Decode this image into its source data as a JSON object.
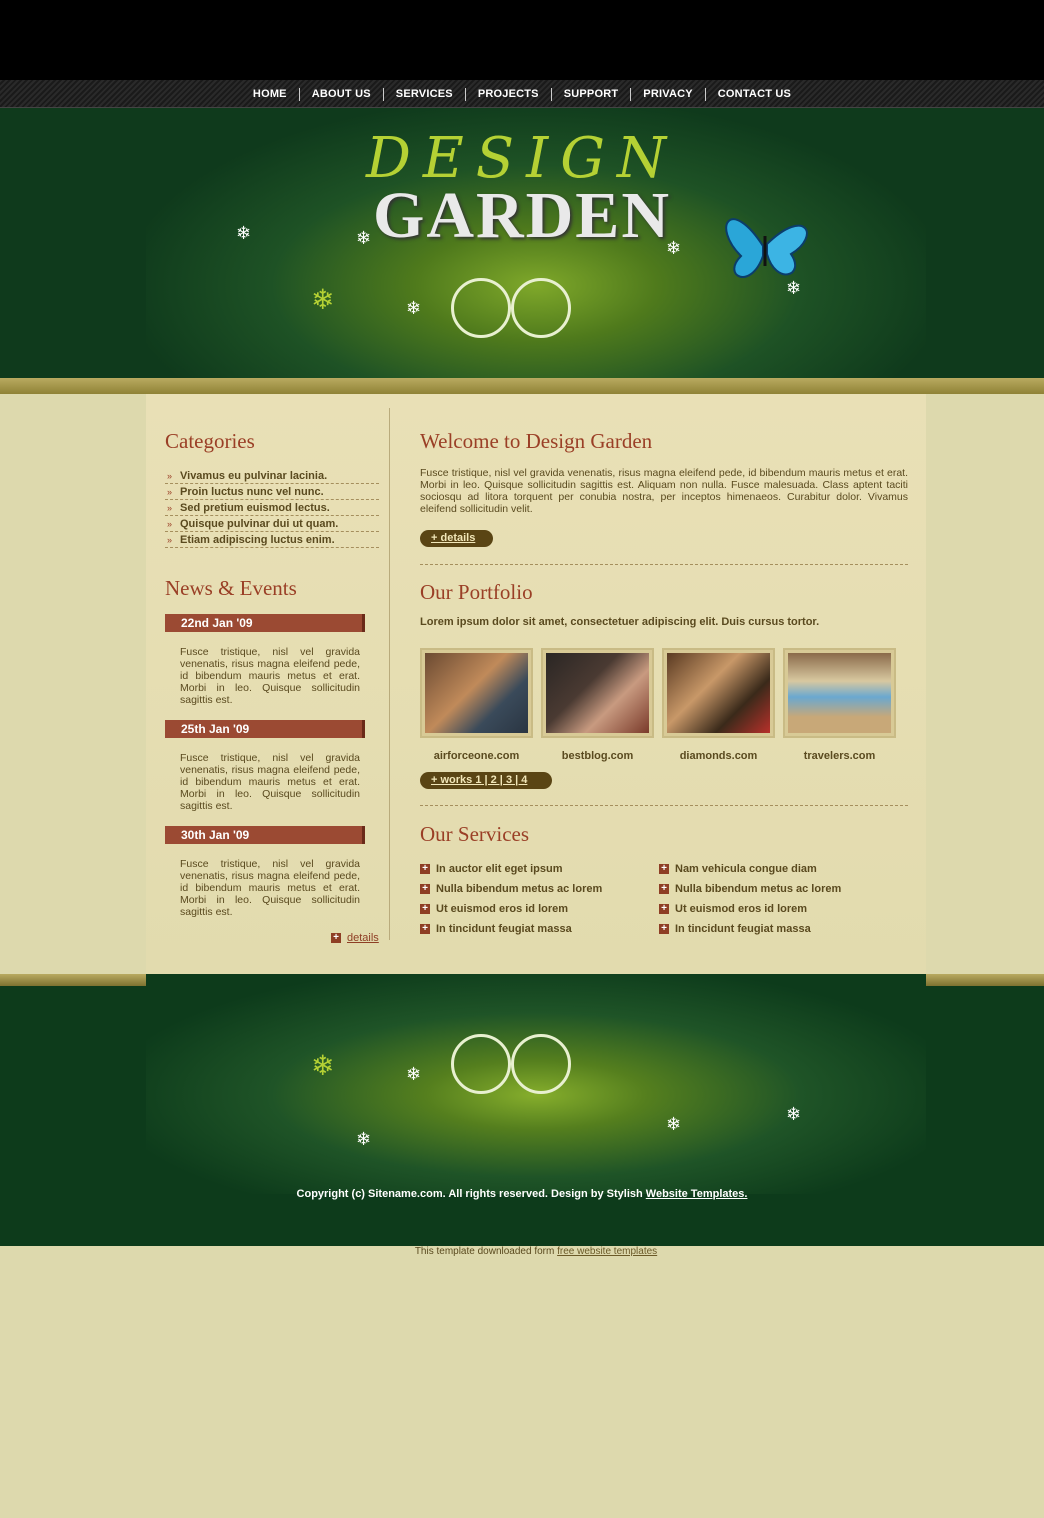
{
  "nav": {
    "items": [
      {
        "label": "HOME"
      },
      {
        "label": "ABOUT US"
      },
      {
        "label": "SERVICES"
      },
      {
        "label": "PROJECTS"
      },
      {
        "label": "SUPPORT"
      },
      {
        "label": "PRIVACY"
      },
      {
        "label": "CONTACT US"
      }
    ]
  },
  "logo": {
    "top": "DESIGN",
    "bottom": "GARDEN"
  },
  "categories": {
    "title": "Categories",
    "items": [
      "Vivamus eu pulvinar lacinia.",
      "Proin luctus nunc vel nunc.",
      "Sed pretium euismod lectus.",
      "Quisque pulvinar dui ut quam.",
      "Etiam adipiscing luctus enim."
    ]
  },
  "news": {
    "title": "News & Events",
    "items": [
      {
        "date": "22nd Jan '09",
        "text": "Fusce tristique, nisl vel gravida venenatis, risus magna eleifend pede, id bibendum mauris metus et erat. Morbi in leo. Quisque sollicitudin sagittis est."
      },
      {
        "date": "25th Jan '09",
        "text": "Fusce tristique, nisl vel gravida venenatis, risus magna eleifend pede, id bibendum mauris metus et erat. Morbi in leo. Quisque sollicitudin sagittis est."
      },
      {
        "date": "30th Jan '09",
        "text": "Fusce tristique, nisl vel gravida venenatis, risus magna eleifend pede, id bibendum mauris metus et erat. Morbi in leo. Quisque sollicitudin sagittis est."
      }
    ],
    "details_label": "details"
  },
  "welcome": {
    "title": "Welcome to Design Garden",
    "text": "Fusce tristique, nisl vel gravida venenatis, risus magna eleifend pede, id bibendum mauris metus et erat. Morbi in leo. Quisque sollicitudin sagittis est. Aliquam non nulla. Fusce malesuada. Class aptent taciti sociosqu ad litora torquent per conubia nostra, per inceptos himenaeos. Curabitur dolor. Vivamus eleifend sollicitudin velit.",
    "details_label": "+ details"
  },
  "portfolio": {
    "title": "Our Portfolio",
    "lead": "Lorem ipsum dolor sit amet, consectetuer adipiscing elit. Duis cursus tortor.",
    "items": [
      {
        "label": "airforceone.com"
      },
      {
        "label": "bestblog.com"
      },
      {
        "label": "diamonds.com"
      },
      {
        "label": "travelers.com"
      }
    ],
    "works_label": "+ works 1 | 2 | 3 | 4"
  },
  "services": {
    "title": "Our Services",
    "col1": [
      "In auctor elit eget ipsum",
      "Nulla bibendum metus ac lorem",
      "Ut euismod eros id lorem",
      "In tincidunt feugiat massa"
    ],
    "col2": [
      "Nam vehicula congue diam",
      "Nulla bibendum metus ac lorem",
      "Ut euismod eros id lorem",
      "In tincidunt feugiat massa"
    ]
  },
  "footer": {
    "copyright_prefix": "Copyright (c) Sitename.com. All rights reserved. Design by Stylish ",
    "copyright_link": "Website Templates.",
    "downloaded_prefix": "This template downloaded form ",
    "downloaded_link": "free website templates"
  }
}
